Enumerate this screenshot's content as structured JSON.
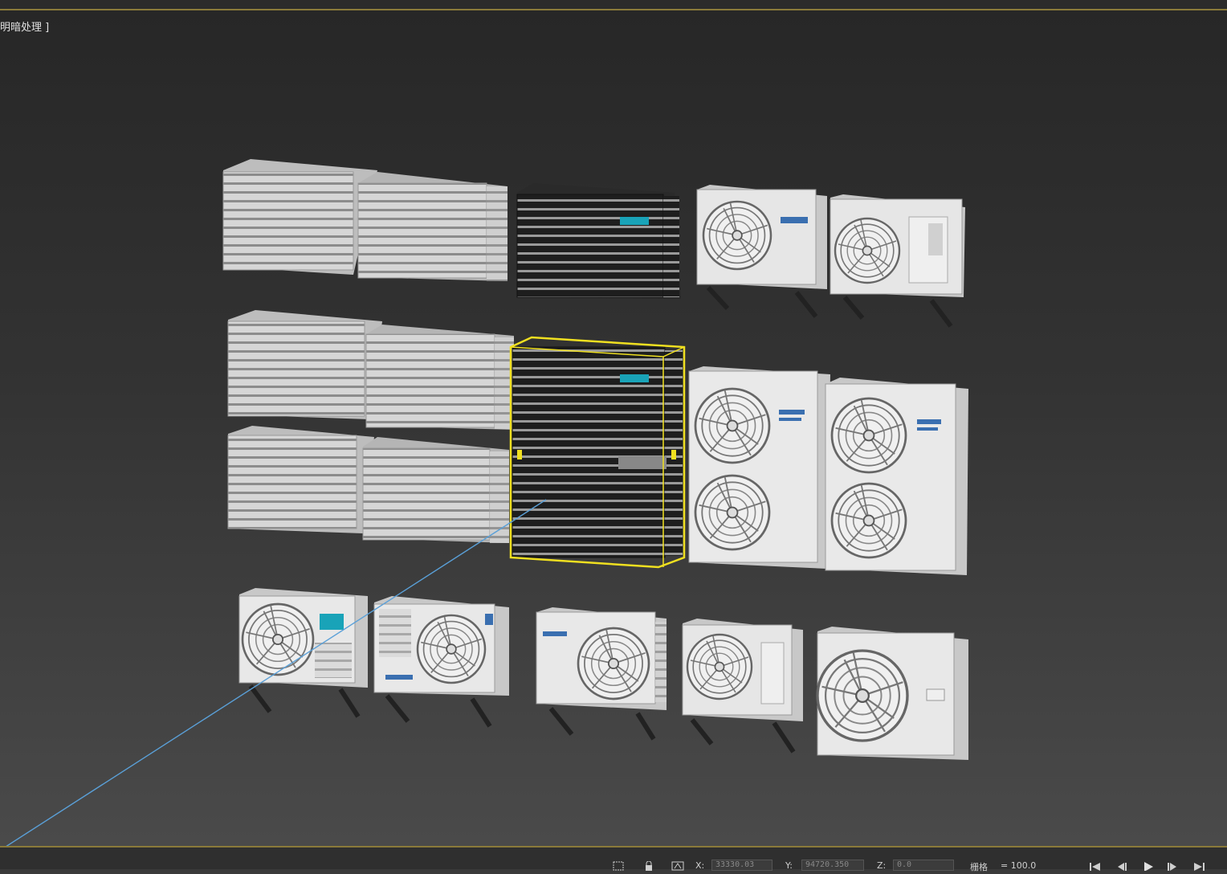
{
  "viewport": {
    "label_bracket": "[",
    "label": "明暗处理",
    "label_close": "]"
  },
  "status": {
    "x_label": "X:",
    "x_value": "33330.03",
    "y_label": "Y:",
    "y_value": "94720.350",
    "z_label": "Z:",
    "z_value": "0.0",
    "grid_label": "栅格",
    "grid_value": "= 100.0"
  },
  "colors": {
    "selection": "#f0e020",
    "accent_line": "#8a7a3a",
    "teal_logo": "#19a3b8"
  },
  "icons": [
    "select-icon",
    "lock-icon",
    "absolute-mode-icon",
    "go-start-icon",
    "prev-frame-icon",
    "play-icon",
    "next-frame-icon",
    "go-end-icon"
  ]
}
